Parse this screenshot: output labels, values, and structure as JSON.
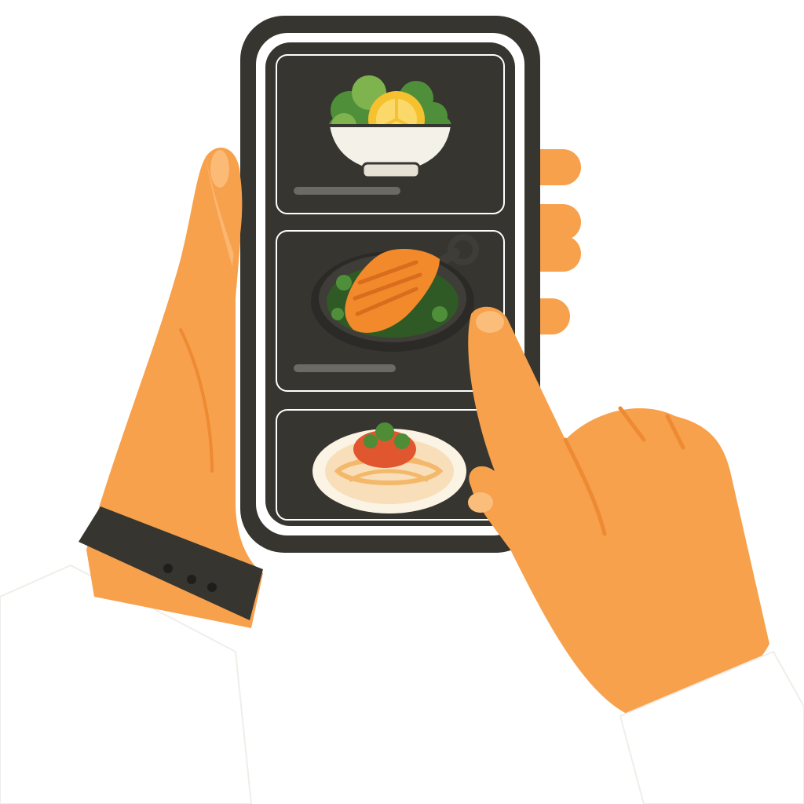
{
  "scene": {
    "description_free": true,
    "palette": {
      "background": "#ffffff",
      "phone_body": "#363530",
      "phone_screen_border": "#ffffff",
      "card_bg": "#363530",
      "text_placeholder": "#6d6a63",
      "skin": "#f7a14c",
      "skin_shadow": "#ee8a34",
      "skin_highlight": "#fbbd7a",
      "watch_band": "#363530",
      "sleeve": "#ffffff",
      "salad_green": "#4f8f3a",
      "salad_leaf_light": "#7fb34d",
      "lemon": "#f6c12e",
      "bowl": "#f4f1e8",
      "salmon": "#f28a2b",
      "salmon_stripe": "#d96c1d",
      "pan": "#3f3d38",
      "greens_dark": "#2f5a26",
      "plate": "#fbf3e4",
      "pasta": "#f3b86a",
      "sauce": "#e0562f",
      "basil": "#4e8c35"
    }
  },
  "phone": {
    "cards": [
      {
        "icon": "salad-bowl-icon",
        "has_text_placeholder": true
      },
      {
        "icon": "salmon-pan-icon",
        "has_text_placeholder": true
      },
      {
        "icon": "pasta-plate-icon",
        "has_text_placeholder": false
      }
    ]
  }
}
